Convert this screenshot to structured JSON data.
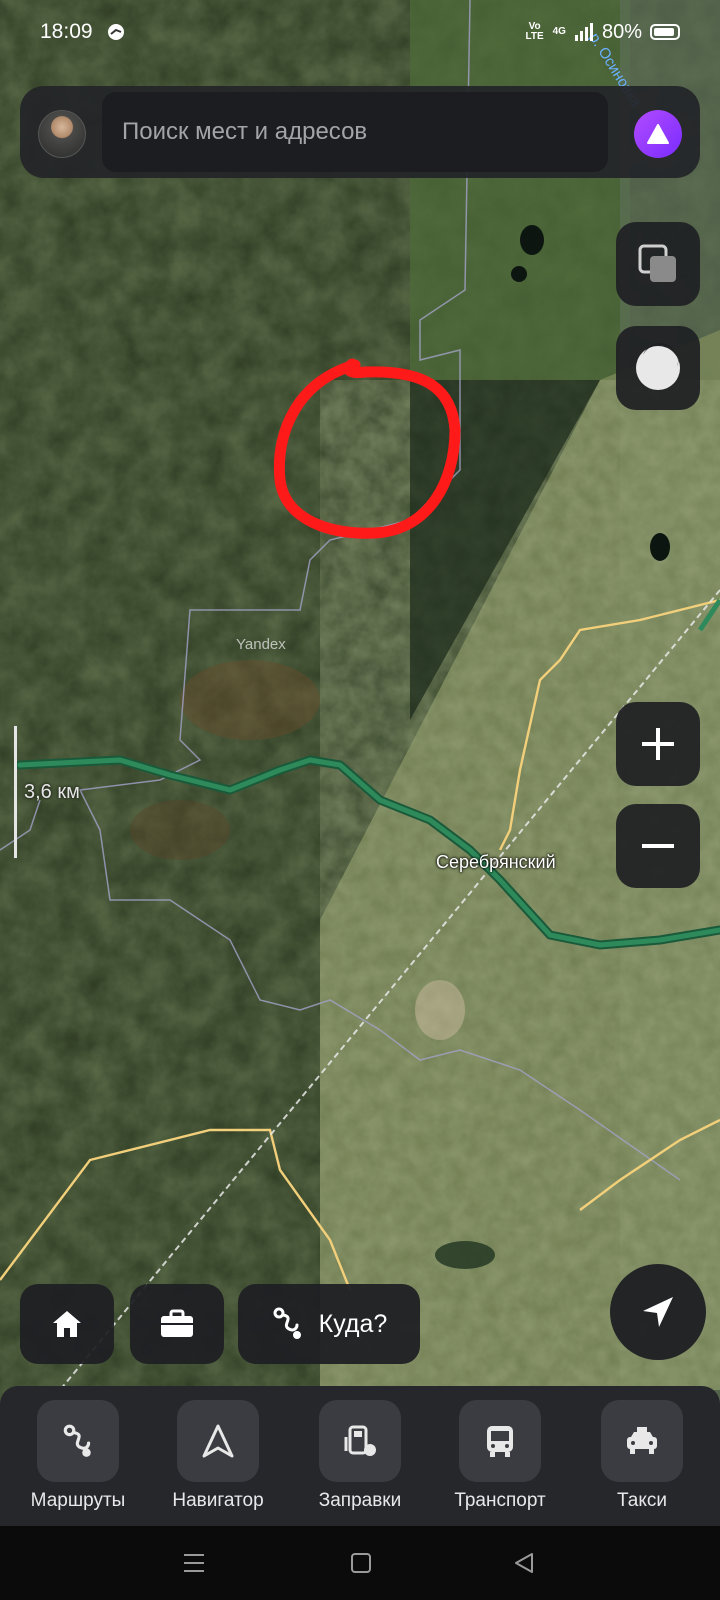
{
  "status_bar": {
    "time": "18:09",
    "net_volte": "Vo LTE",
    "net_4g": "4G",
    "battery": "80%"
  },
  "search": {
    "placeholder": "Поиск мест и адресов"
  },
  "map": {
    "scale_label": "3,6 км",
    "city_label": "Серебрянский",
    "watermark": "Yandex",
    "river_label": "р. Осиновка",
    "route_color": "#2e8a5a",
    "annotation_color": "#ff1a1a"
  },
  "quick_actions": {
    "where_to_label": "Куда?"
  },
  "bottom_nav": {
    "items": [
      {
        "label": "Маршруты",
        "icon": "routes-icon"
      },
      {
        "label": "Навигатор",
        "icon": "navigator-arrow-icon"
      },
      {
        "label": "Заправки",
        "icon": "fuel-station-icon"
      },
      {
        "label": "Транспорт",
        "icon": "bus-icon"
      },
      {
        "label": "Такси",
        "icon": "taxi-icon"
      }
    ]
  },
  "system_nav": {
    "icons": [
      "recents-icon",
      "home-square-icon",
      "back-triangle-icon"
    ]
  }
}
